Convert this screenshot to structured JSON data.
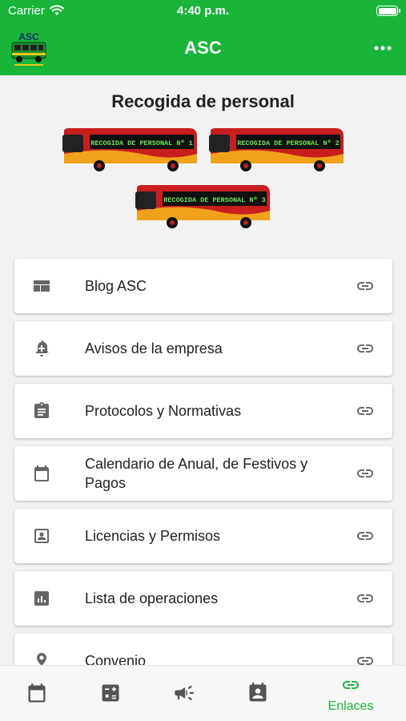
{
  "status_bar": {
    "carrier": "Carrier",
    "time": "4:40 p.m."
  },
  "app_bar": {
    "title": "ASC",
    "logo_text": "ASC"
  },
  "page": {
    "title": "Recogida de personal"
  },
  "buses": [
    {
      "sign": "RECOGIDA DE PERSONAL Nº 1"
    },
    {
      "sign": "RECOGIDA DE PERSONAL Nº 2"
    },
    {
      "sign": "RECOGIDA DE PERSONAL Nº 3"
    }
  ],
  "links": [
    {
      "label": "Blog ASC",
      "icon": "web-icon"
    },
    {
      "label": "Avisos de la empresa",
      "icon": "bell-plus-icon"
    },
    {
      "label": "Protocolos y Normativas",
      "icon": "clipboard-icon"
    },
    {
      "label": "Calendario de Anual, de Festivos y Pagos",
      "icon": "calendar-icon"
    },
    {
      "label": "Licencias y Permisos",
      "icon": "portrait-icon"
    },
    {
      "label": "Lista de operaciones",
      "icon": "chart-icon"
    },
    {
      "label": "Convenio",
      "icon": "location-icon"
    }
  ],
  "bottom_nav": {
    "items": [
      {
        "icon": "calendar-icon",
        "label": ""
      },
      {
        "icon": "calculator-icon",
        "label": ""
      },
      {
        "icon": "megaphone-icon",
        "label": ""
      },
      {
        "icon": "contact-card-icon",
        "label": ""
      },
      {
        "icon": "link-icon",
        "label": "Enlaces"
      }
    ]
  },
  "colors": {
    "brand_green": "#19b53a",
    "icon_gray": "#666666",
    "text": "#222222"
  }
}
